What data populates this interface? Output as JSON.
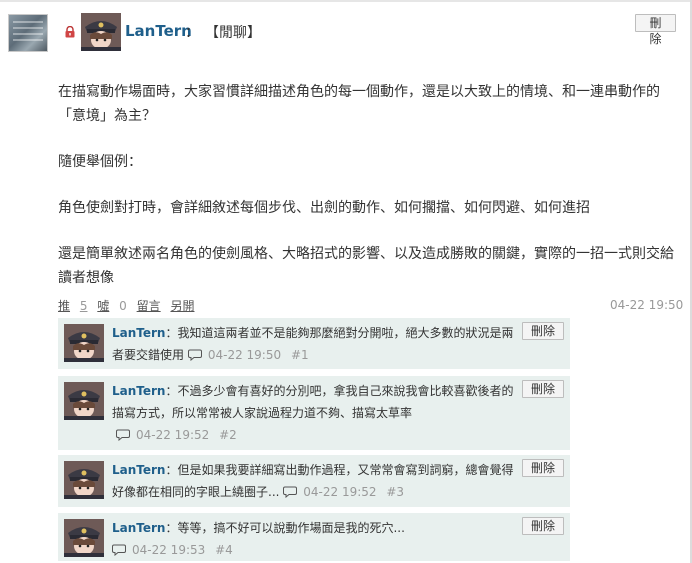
{
  "post": {
    "author": "LanTern",
    "title_separator": "：",
    "title": "【閒聊】",
    "delete_label": "刪除",
    "body": [
      "在描寫動作場面時，大家習慣詳細描述角色的每一個動作，還是以大致上的情境、和一連串動作的「意境」為主？",
      "隨便舉個例：",
      "角色使劍對打時，會詳細敘述每個步伐、出劍的動作、如何擱擋、如何閃避、如何進招",
      "還是簡單敘述兩名角色的使劍風格、大略招式的影響、以及造成勝敗的關鍵，實際的一招一式則交給讀者想像"
    ],
    "actions": {
      "push_label": "推",
      "push_count": "5",
      "boo_label": "噓",
      "boo_count": "0",
      "reply_label": "留言",
      "view_label": "另開"
    },
    "time": "04-22 19:50"
  },
  "replies": [
    {
      "name": "LanTern",
      "text": "：我知道這兩者並不是能夠那麼絕對分開啦，絕大多數的狀況是兩者要交錯使用",
      "time": "04-22 19:50",
      "floor": "#1",
      "delete_label": "刪除"
    },
    {
      "name": "LanTern",
      "text": "：不過多少會有喜好的分別吧，拿我自己來說我會比較喜歡後者的描寫方式，所以常常被人家說過程力道不夠、描寫太草率",
      "time": "04-22 19:52",
      "floor": "#2",
      "delete_label": "刪除"
    },
    {
      "name": "LanTern",
      "text": "：但是如果我要詳細寫出動作過程，又常常會寫到詞窮，總會覺得好像都在相同的字眼上繞圈子...",
      "time": "04-22 19:52",
      "floor": "#3",
      "delete_label": "刪除"
    },
    {
      "name": "LanTern",
      "text": "：等等，搞不好可以說動作場面是我的死穴...",
      "time": "04-22 19:53",
      "floor": "#4",
      "delete_label": "刪除"
    }
  ]
}
